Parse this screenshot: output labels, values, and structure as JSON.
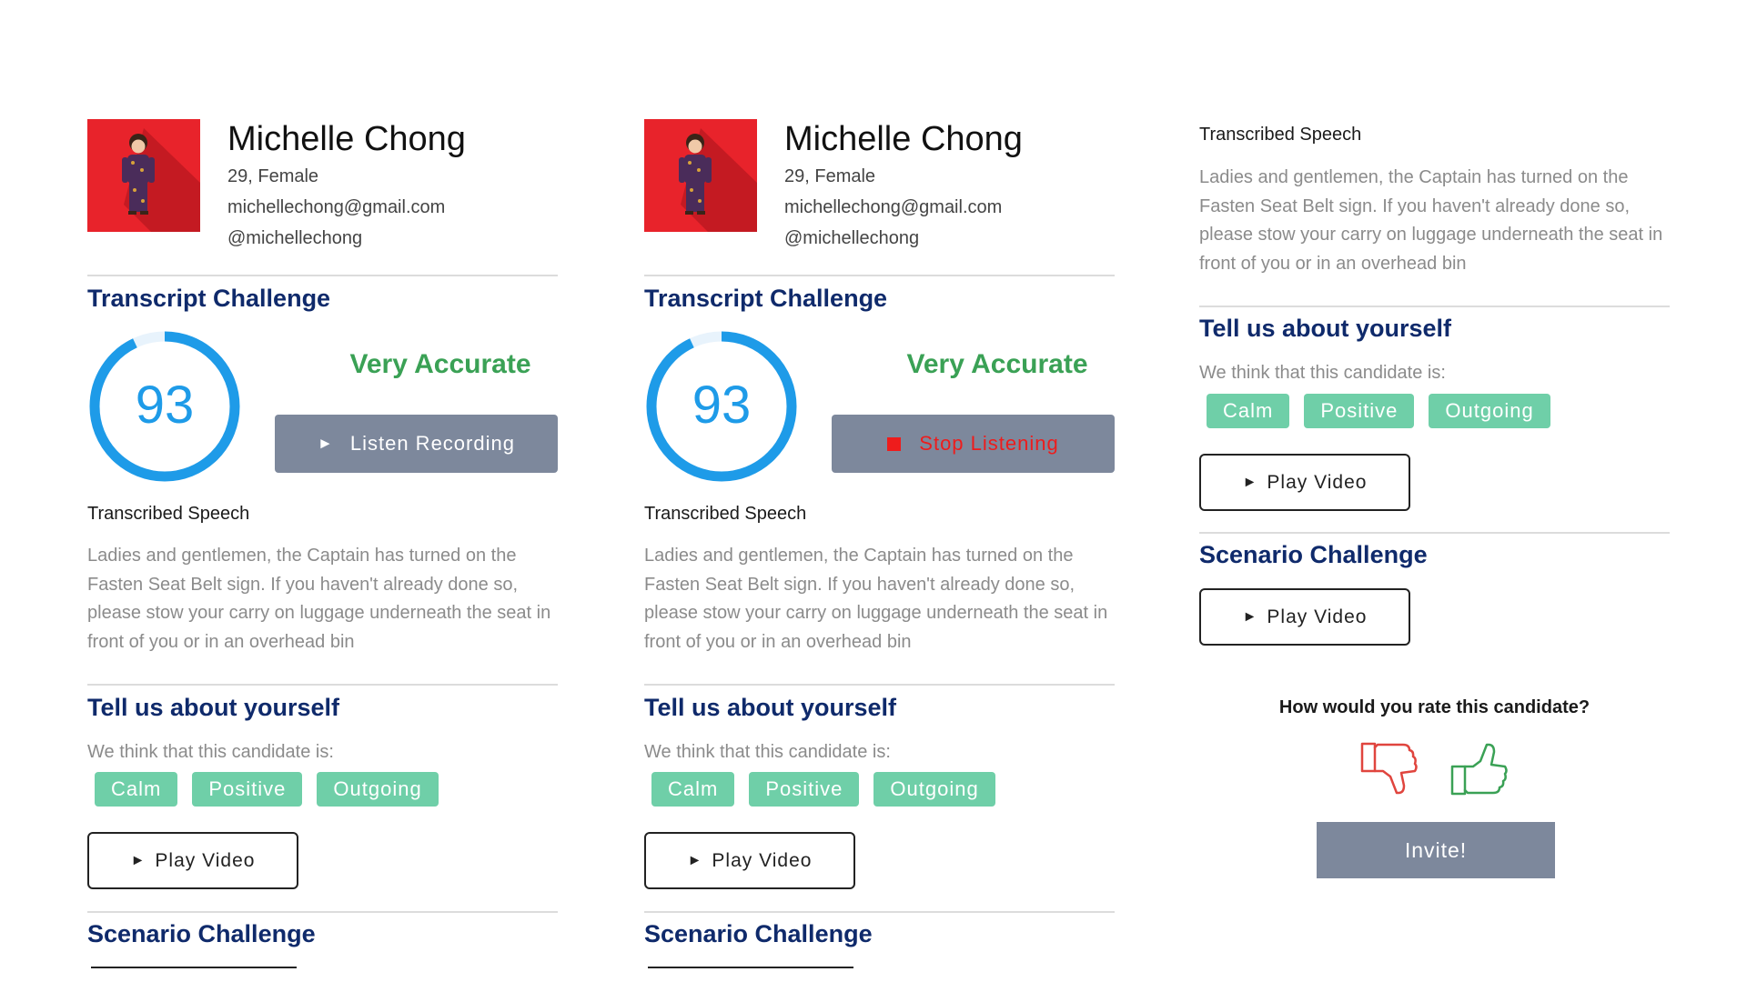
{
  "candidate": {
    "name": "Michelle Chong",
    "age_gender": "29, Female",
    "email": "michellechong@gmail.com",
    "handle": "@michellechong"
  },
  "transcript_challenge": {
    "title": "Transcript Challenge",
    "score": "93",
    "score_fraction": 0.93,
    "accuracy_label": "Very Accurate",
    "listen_button": "Listen Recording",
    "stop_button": "Stop Listening",
    "speech_heading": "Transcribed Speech",
    "speech_text": "Ladies and gentlemen, the Captain has turned on the Fasten Seat Belt sign. If you haven't already done so, please stow your carry on luggage underneath the seat in front of you or in an overhead bin"
  },
  "about": {
    "title": "Tell us about yourself",
    "note": "We think that this candidate is:",
    "traits": [
      "Calm",
      "Positive",
      "Outgoing"
    ],
    "play_button": "Play Video"
  },
  "scenario": {
    "title": "Scenario Challenge",
    "play_button": "Play Video"
  },
  "rating": {
    "question": "How would you rate this candidate?",
    "invite_button": "Invite!"
  },
  "icons": {
    "play": "play-icon",
    "stop": "stop-icon",
    "thumbs_down": "thumbs-down-icon",
    "thumbs_up": "thumbs-up-icon"
  },
  "colors": {
    "heading": "#0f2a6b",
    "accuracy": "#3aa155",
    "score_ring": "#1e9be8",
    "tag": "#6fcfa8",
    "button_gray": "#7d889c",
    "stop_red": "#ee1c1c",
    "avatar_bg": "#e8232b",
    "thumbs_down": "#e0453e",
    "thumbs_up": "#3aa155"
  }
}
